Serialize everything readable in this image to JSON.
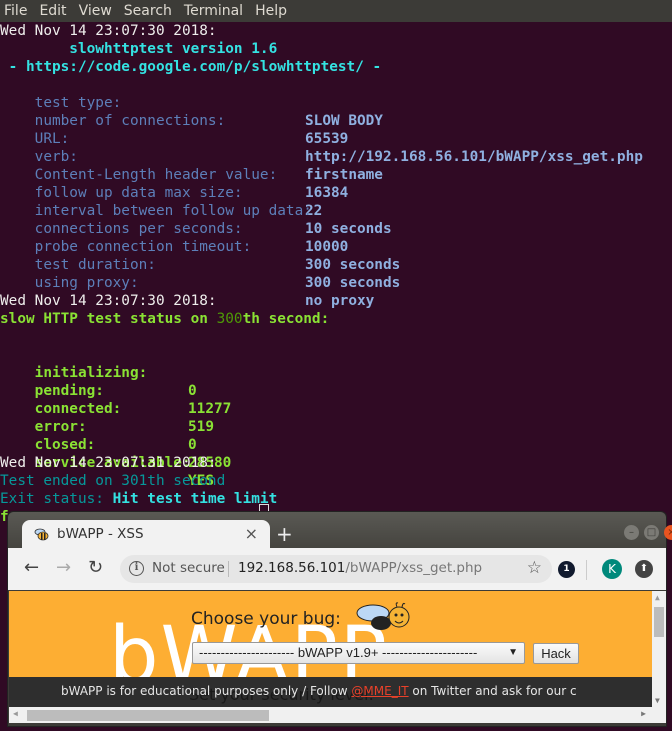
{
  "menubar": {
    "items": [
      "File",
      "Edit",
      "View",
      "Search",
      "Terminal",
      "Help"
    ]
  },
  "terminal": {
    "header": {
      "timestamp": "Wed Nov 14 23:07:30 2018:",
      "version": "        slowhttptest version 1.6",
      "url_line": " - https://code.google.com/p/slowhttptest/ -"
    },
    "config": [
      {
        "label": "test type:",
        "value": "SLOW BODY"
      },
      {
        "label": "number of connections:",
        "value": "65539"
      },
      {
        "label": "URL:",
        "value": "http://192.168.56.101/bWAPP/xss_get.php"
      },
      {
        "label": "verb:",
        "value": "firstname"
      },
      {
        "label": "Content-Length header value:",
        "value": "16384"
      },
      {
        "label": "follow up data max size:",
        "value": "22"
      },
      {
        "label": "interval between follow up data:",
        "value": "10 seconds"
      },
      {
        "label": "connections per seconds:",
        "value": "10000"
      },
      {
        "label": "probe connection timeout:",
        "value": "300 seconds"
      },
      {
        "label": "test duration:",
        "value": "300 seconds"
      },
      {
        "label": "using proxy:",
        "value": "no proxy"
      }
    ],
    "status": {
      "timestamp": "Wed Nov 14 23:07:30 2018:",
      "title_prefix": "slow HTTP test status on ",
      "title_number": "300",
      "title_suffix": "th second:",
      "rows": [
        {
          "label": "initializing:",
          "value": "0"
        },
        {
          "label": "pending:",
          "value": "11277"
        },
        {
          "label": "connected:",
          "value": "519"
        },
        {
          "label": "error:",
          "value": "0"
        },
        {
          "label": "closed:",
          "value": "28580"
        },
        {
          "label": "service available:",
          "value": "YES"
        }
      ]
    },
    "end": {
      "timestamp": "Wed Nov 14 23:07:31 2018:",
      "ended": "Test ended on 301th second",
      "exit_label": "Exit status: ",
      "exit_value": "Hit test time limit",
      "partial": "f"
    }
  },
  "browser": {
    "tab": {
      "title": "bWAPP - XSS",
      "close": "×"
    },
    "new_tab": "+",
    "window_buttons": {
      "minimize": "–",
      "maximize": "□",
      "close": "×"
    },
    "nav": {
      "back": "←",
      "forward": "→",
      "reload": "↻"
    },
    "omnibox": {
      "info": "i",
      "security": "Not secure",
      "host": "192.168.56.101",
      "path": "/bWAPP/xss_get.php",
      "star": "☆"
    },
    "extension_badge": "1",
    "profile_initial": "K",
    "update_icon": "⬆",
    "page": {
      "logo_text": "bWAPP",
      "choose_label": "Choose your bug:",
      "select_value": "---------------------- bWAPP v1.9+ ----------------------",
      "select_arrow": "▼",
      "hack_button": "Hack",
      "footer_prefix": "bWAPP is for educational purposes only / Follow ",
      "footer_link": "@MME_IT",
      "footer_suffix": " on Twitter and ask for our c",
      "ghost_text": "Set your security level:"
    },
    "scroll": {
      "up": "▲",
      "down": "▼",
      "left": "◀",
      "right": "▶"
    }
  }
}
